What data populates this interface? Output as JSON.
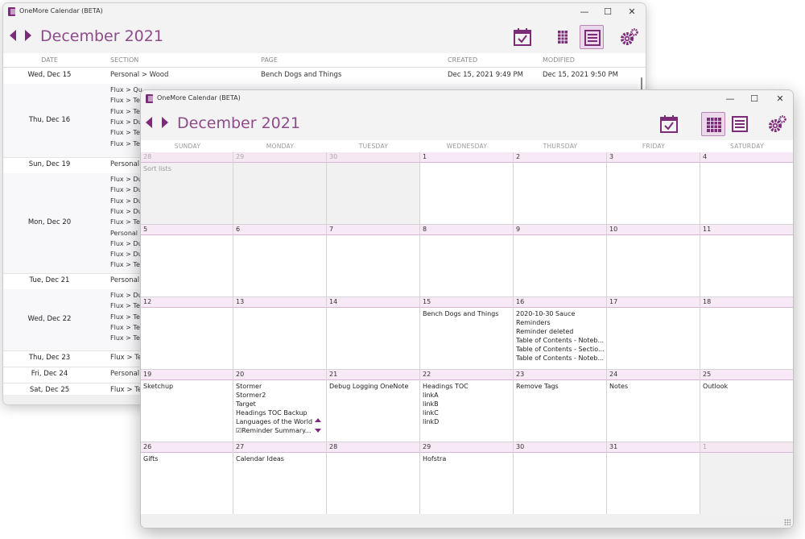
{
  "back_window": {
    "title": "OneMore Calendar (BETA)",
    "controls": {
      "minimize": "—",
      "maximize": "☐",
      "close": "✕"
    },
    "month": "December 2021",
    "columns": {
      "date": "DATE",
      "section": "SECTION",
      "page": "PAGE",
      "created": "CREATED",
      "modified": "MODIFIED"
    },
    "rows": [
      {
        "date": "Wed, Dec 15",
        "sections": [
          "Personal > Wood"
        ],
        "page": "Bench Dogs and Things",
        "created": "Dec 15, 2021 9:49 PM",
        "modified": "Dec 15, 2021 9:50 PM"
      },
      {
        "date": "Thu, Dec 16",
        "sections": [
          "Flux > Qu",
          "Flux > Te",
          "Flux > Te",
          "Flux > Du",
          "Flux > Te",
          "Flux > Te"
        ]
      },
      {
        "date": "Sun, Dec 19",
        "sections": [
          "Personal"
        ]
      },
      {
        "date": "Mon, Dec 20",
        "sections": [
          "Flux > Du",
          "Flux > Du",
          "Flux > Du",
          "Flux > Du",
          "Flux > Te",
          "Personal",
          "Flux > Du",
          "Flux > Du",
          "Flux > Te"
        ]
      },
      {
        "date": "Tue, Dec 21",
        "sections": [
          "Personal"
        ]
      },
      {
        "date": "Wed, Dec 22",
        "sections": [
          "Flux > Du",
          "Flux > Te",
          "Flux > Te",
          "Flux > Te",
          "Flux > Te"
        ]
      },
      {
        "date": "Thu, Dec 23",
        "sections": [
          "Flux > Te"
        ]
      },
      {
        "date": "Fri, Dec 24",
        "sections": [
          "Personal"
        ]
      },
      {
        "date": "Sat, Dec 25",
        "sections": [
          "Flux > Te"
        ]
      }
    ]
  },
  "front_window": {
    "title": "OneMore Calendar (BETA)",
    "controls": {
      "minimize": "—",
      "maximize": "☐",
      "close": "✕"
    },
    "month": "December 2021",
    "day_names": [
      "SUNDAY",
      "MONDAY",
      "TUESDAY",
      "WEDNESDAY",
      "THURSDAY",
      "FRIDAY",
      "SATURDAY"
    ],
    "weeks": [
      [
        {
          "day": "28",
          "other": true,
          "pages": [
            "Sort lists"
          ]
        },
        {
          "day": "29",
          "other": true,
          "pages": []
        },
        {
          "day": "30",
          "other": true,
          "pages": []
        },
        {
          "day": "1",
          "pages": []
        },
        {
          "day": "2",
          "pages": []
        },
        {
          "day": "3",
          "pages": []
        },
        {
          "day": "4",
          "pages": []
        }
      ],
      [
        {
          "day": "5",
          "pages": []
        },
        {
          "day": "6",
          "pages": []
        },
        {
          "day": "7",
          "pages": []
        },
        {
          "day": "8",
          "pages": []
        },
        {
          "day": "9",
          "pages": []
        },
        {
          "day": "10",
          "pages": []
        },
        {
          "day": "11",
          "pages": []
        }
      ],
      [
        {
          "day": "12",
          "pages": []
        },
        {
          "day": "13",
          "pages": []
        },
        {
          "day": "14",
          "pages": []
        },
        {
          "day": "15",
          "pages": [
            "Bench Dogs and Things"
          ]
        },
        {
          "day": "16",
          "pages": [
            "2020-10-30 Sauce",
            "Reminders",
            "Reminder deleted",
            "Table of Contents - Noteb...",
            "Table of Contents - Sectio...",
            "Table of Contents - Noteb..."
          ]
        },
        {
          "day": "17",
          "pages": []
        },
        {
          "day": "18",
          "pages": []
        }
      ],
      [
        {
          "day": "19",
          "pages": [
            "Sketchup"
          ]
        },
        {
          "day": "20",
          "pages": [
            "Stormer",
            "Stormer2",
            "Target",
            "Headings TOC Backup",
            "Languages of the World",
            "☑Reminder  Summary..."
          ],
          "more": true
        },
        {
          "day": "21",
          "pages": [
            "Debug Logging OneNote"
          ]
        },
        {
          "day": "22",
          "pages": [
            "Headings TOC",
            "linkA",
            "linkB",
            "linkC",
            "linkD"
          ]
        },
        {
          "day": "23",
          "pages": [
            "Remove Tags"
          ]
        },
        {
          "day": "24",
          "pages": [
            "Notes"
          ]
        },
        {
          "day": "25",
          "pages": [
            "Outlook"
          ]
        }
      ],
      [
        {
          "day": "26",
          "pages": [
            "Gifts"
          ]
        },
        {
          "day": "27",
          "pages": [
            "Calendar Ideas"
          ]
        },
        {
          "day": "28",
          "pages": []
        },
        {
          "day": "29",
          "pages": [
            "Hofstra"
          ]
        },
        {
          "day": "30",
          "pages": []
        },
        {
          "day": "31",
          "pages": []
        },
        {
          "day": "1",
          "other": true,
          "pages": []
        }
      ]
    ]
  },
  "icons": {
    "accent": "#7b2b78",
    "today": "calendar-check-icon",
    "month_view": "grid-view-icon",
    "list_view": "list-view-icon",
    "settings": "gears-icon"
  }
}
